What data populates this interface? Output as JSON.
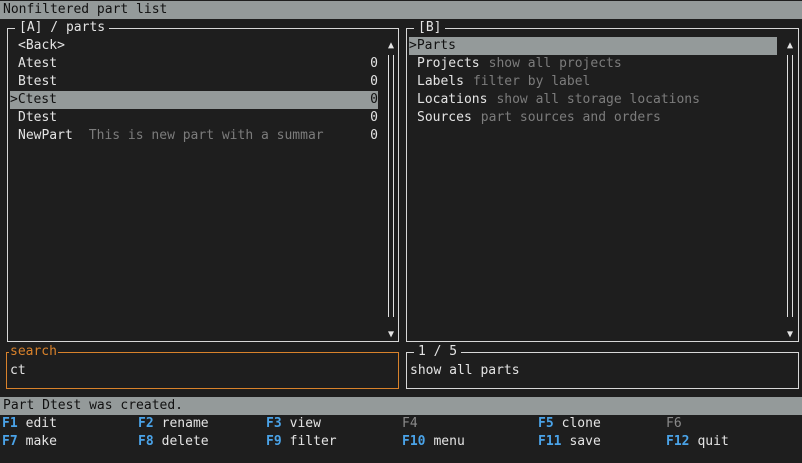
{
  "title_bar": "Nonfiltered part list",
  "panel_a": {
    "title": "[A] / parts",
    "items": [
      {
        "label": "<Back>",
        "desc": "",
        "count": ""
      },
      {
        "label": "Atest",
        "desc": "",
        "count": "0"
      },
      {
        "label": "Btest",
        "desc": "",
        "count": "0"
      },
      {
        "label": ">Ctest",
        "desc": "",
        "count": "0",
        "selected": true
      },
      {
        "label": "Dtest",
        "desc": "",
        "count": "0"
      },
      {
        "label": "NewPart",
        "desc": "This is new part with a summar",
        "count": "0"
      }
    ]
  },
  "panel_b": {
    "title": "[B]",
    "items": [
      {
        "label": ">Parts",
        "desc": "",
        "selected": true
      },
      {
        "label": "Projects",
        "desc": "show all projects"
      },
      {
        "label": "Labels",
        "desc": "filter by label"
      },
      {
        "label": "Locations",
        "desc": "show all storage locations"
      },
      {
        "label": "Sources",
        "desc": "part sources and orders"
      }
    ]
  },
  "search": {
    "title": "search",
    "value": "ct"
  },
  "info": {
    "title": "1 / 5",
    "text": "show all parts"
  },
  "status": "Part Dtest was created.",
  "fkeys": [
    {
      "key": "F1",
      "label": "edit",
      "enabled": true
    },
    {
      "key": "F2",
      "label": "rename",
      "enabled": true
    },
    {
      "key": "F3",
      "label": "view",
      "enabled": true
    },
    {
      "key": "F4",
      "label": "",
      "enabled": false
    },
    {
      "key": "F5",
      "label": "clone",
      "enabled": true
    },
    {
      "key": "F6",
      "label": "",
      "enabled": false
    },
    {
      "key": "F7",
      "label": "make",
      "enabled": true
    },
    {
      "key": "F8",
      "label": "delete",
      "enabled": true
    },
    {
      "key": "F9",
      "label": "filter",
      "enabled": true
    },
    {
      "key": "F10",
      "label": "menu",
      "enabled": true
    },
    {
      "key": "F11",
      "label": "save",
      "enabled": true
    },
    {
      "key": "F12",
      "label": "quit",
      "enabled": true
    }
  ],
  "colors": {
    "accent": "#4aa3e8",
    "search_border": "#d9822b",
    "selection": "#949a9a"
  },
  "icons": {
    "scroll_up": "▲",
    "scroll_down": "▼"
  }
}
